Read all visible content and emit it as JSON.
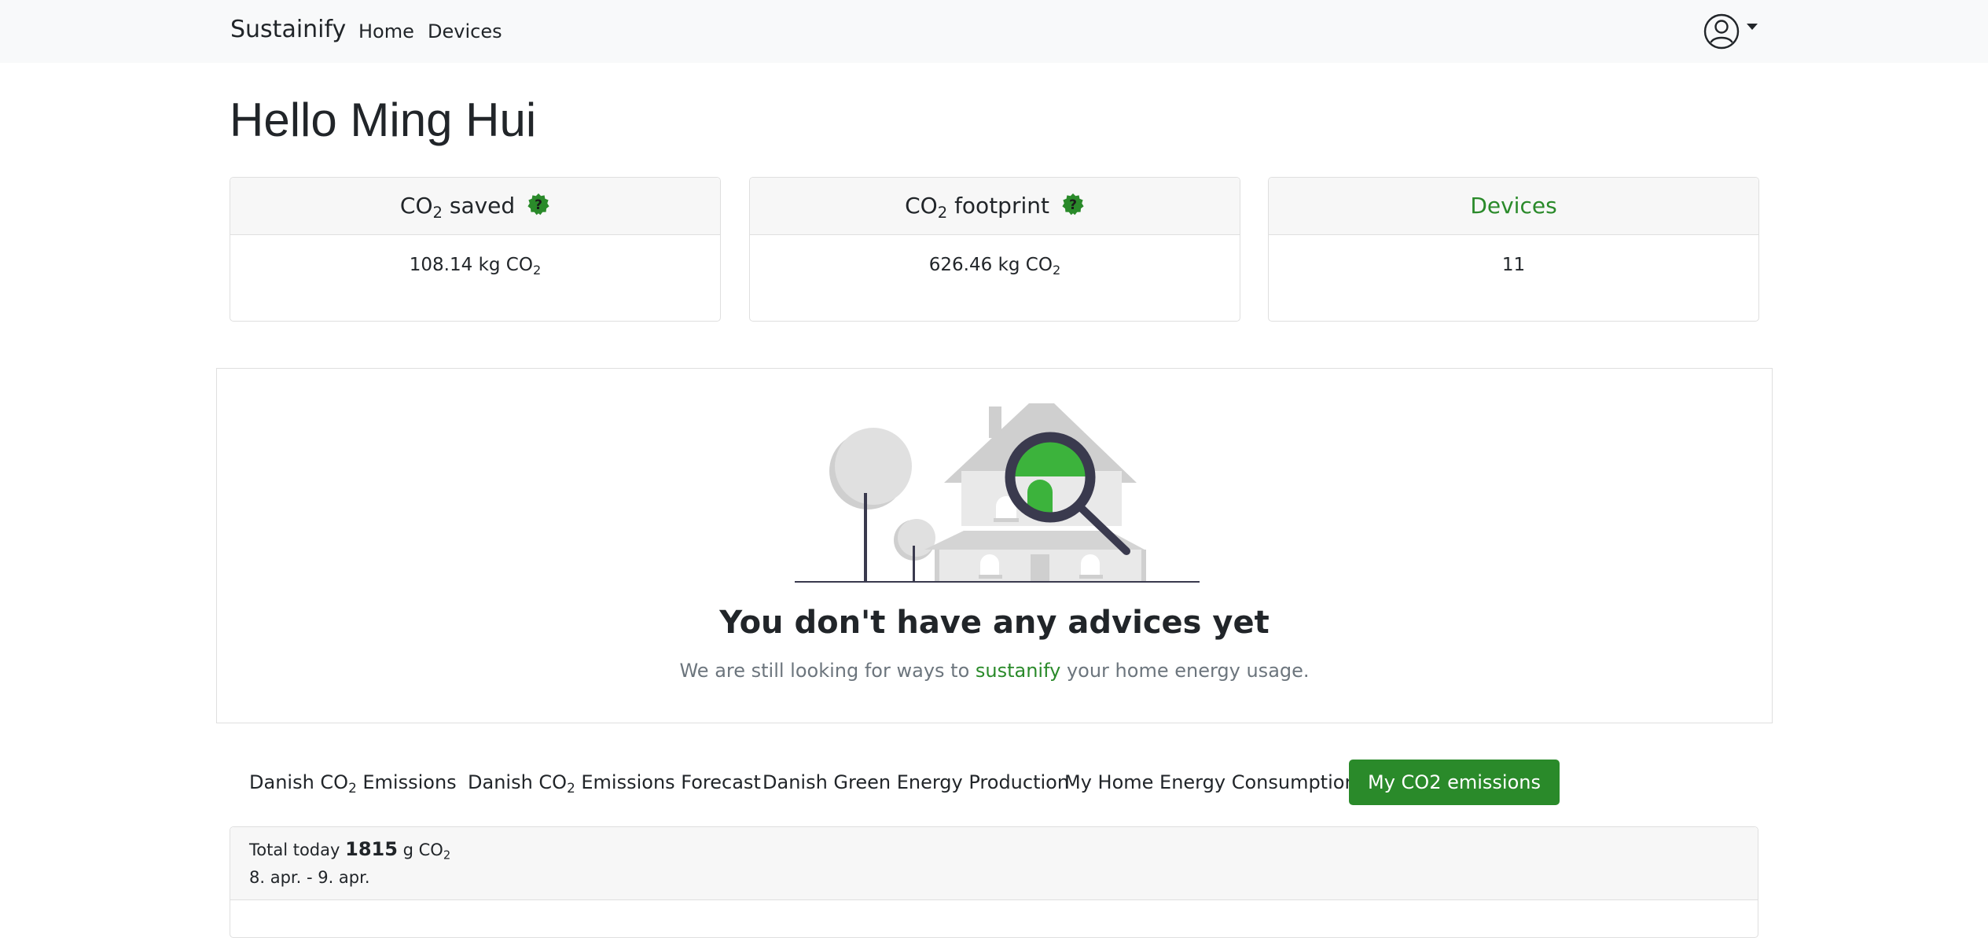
{
  "nav": {
    "brand": "Sustainify",
    "links": [
      "Home",
      "Devices"
    ]
  },
  "greeting": "Hello Ming Hui",
  "cards": [
    {
      "title_pre": "CO",
      "title_sub": "2",
      "title_post": " saved",
      "value_pre": "108.14 kg CO",
      "value_sub": "2"
    },
    {
      "title_pre": "CO",
      "title_sub": "2",
      "title_post": " footprint",
      "value_pre": "626.46 kg CO",
      "value_sub": "2"
    },
    {
      "title": "Devices",
      "value": "11"
    }
  ],
  "advice": {
    "title": "You don't have any advices yet",
    "sub_pre": "We are still looking for ways to ",
    "sub_link": "sustanify",
    "sub_post": " your home energy usage."
  },
  "tabs": [
    {
      "pre": "Danish CO",
      "sub": "2",
      "post": " Emissions"
    },
    {
      "pre": "Danish CO",
      "sub": "2",
      "post": " Emissions Forecast"
    },
    {
      "label": "Danish Green Energy Production"
    },
    {
      "label": "My Home Energy Consumption"
    },
    {
      "label": "My CO2 emissions"
    }
  ],
  "panel": {
    "total_label": "Total today",
    "total_value": "1815",
    "total_unit_pre": "g CO",
    "total_unit_sub": "2",
    "date_range": "8. apr. - 9. apr."
  },
  "colors": {
    "accent": "#2a8a2a",
    "help_badge": "#2a8a2a"
  }
}
